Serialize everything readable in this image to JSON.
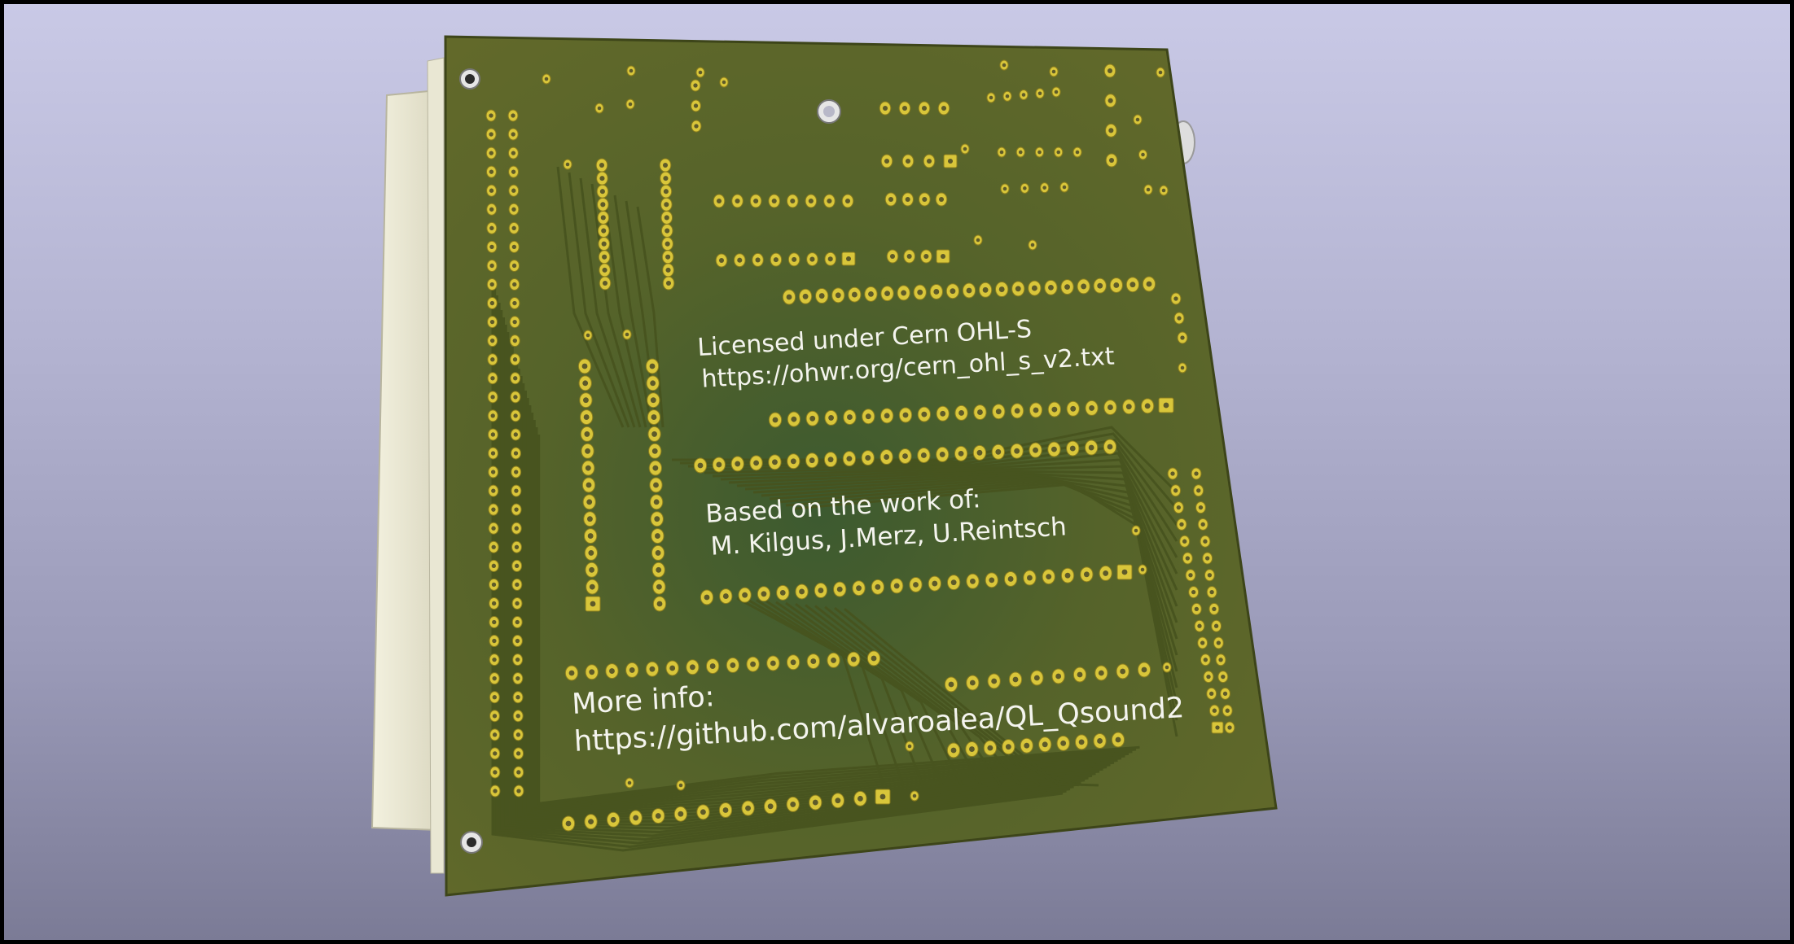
{
  "scene": {
    "description_label": "KiCad 3D viewer — PCB bottom side render",
    "colors": {
      "background_top": "#c9c9e6",
      "background_bottom": "#7b7b96",
      "board": "#5b6529",
      "board_edge": "#3d4519",
      "copper_pad": "#d9c63a",
      "copper_trace": "#4c5620",
      "connector_body": "#ecead7",
      "silkscreen": "#f4f4ee"
    }
  },
  "silkscreen": {
    "license_line1": "Licensed under Cern OHL-S",
    "license_line2": "https://ohwr.org/cern_ohl_s_v2.txt",
    "credits_line1": "Based on the work of:",
    "credits_line2": "M. Kilgus, J.Merz, U.Reintsch",
    "info_line1": "More info:",
    "info_line2": "https://github.com/alvaroalea/QL_Qsound2"
  }
}
